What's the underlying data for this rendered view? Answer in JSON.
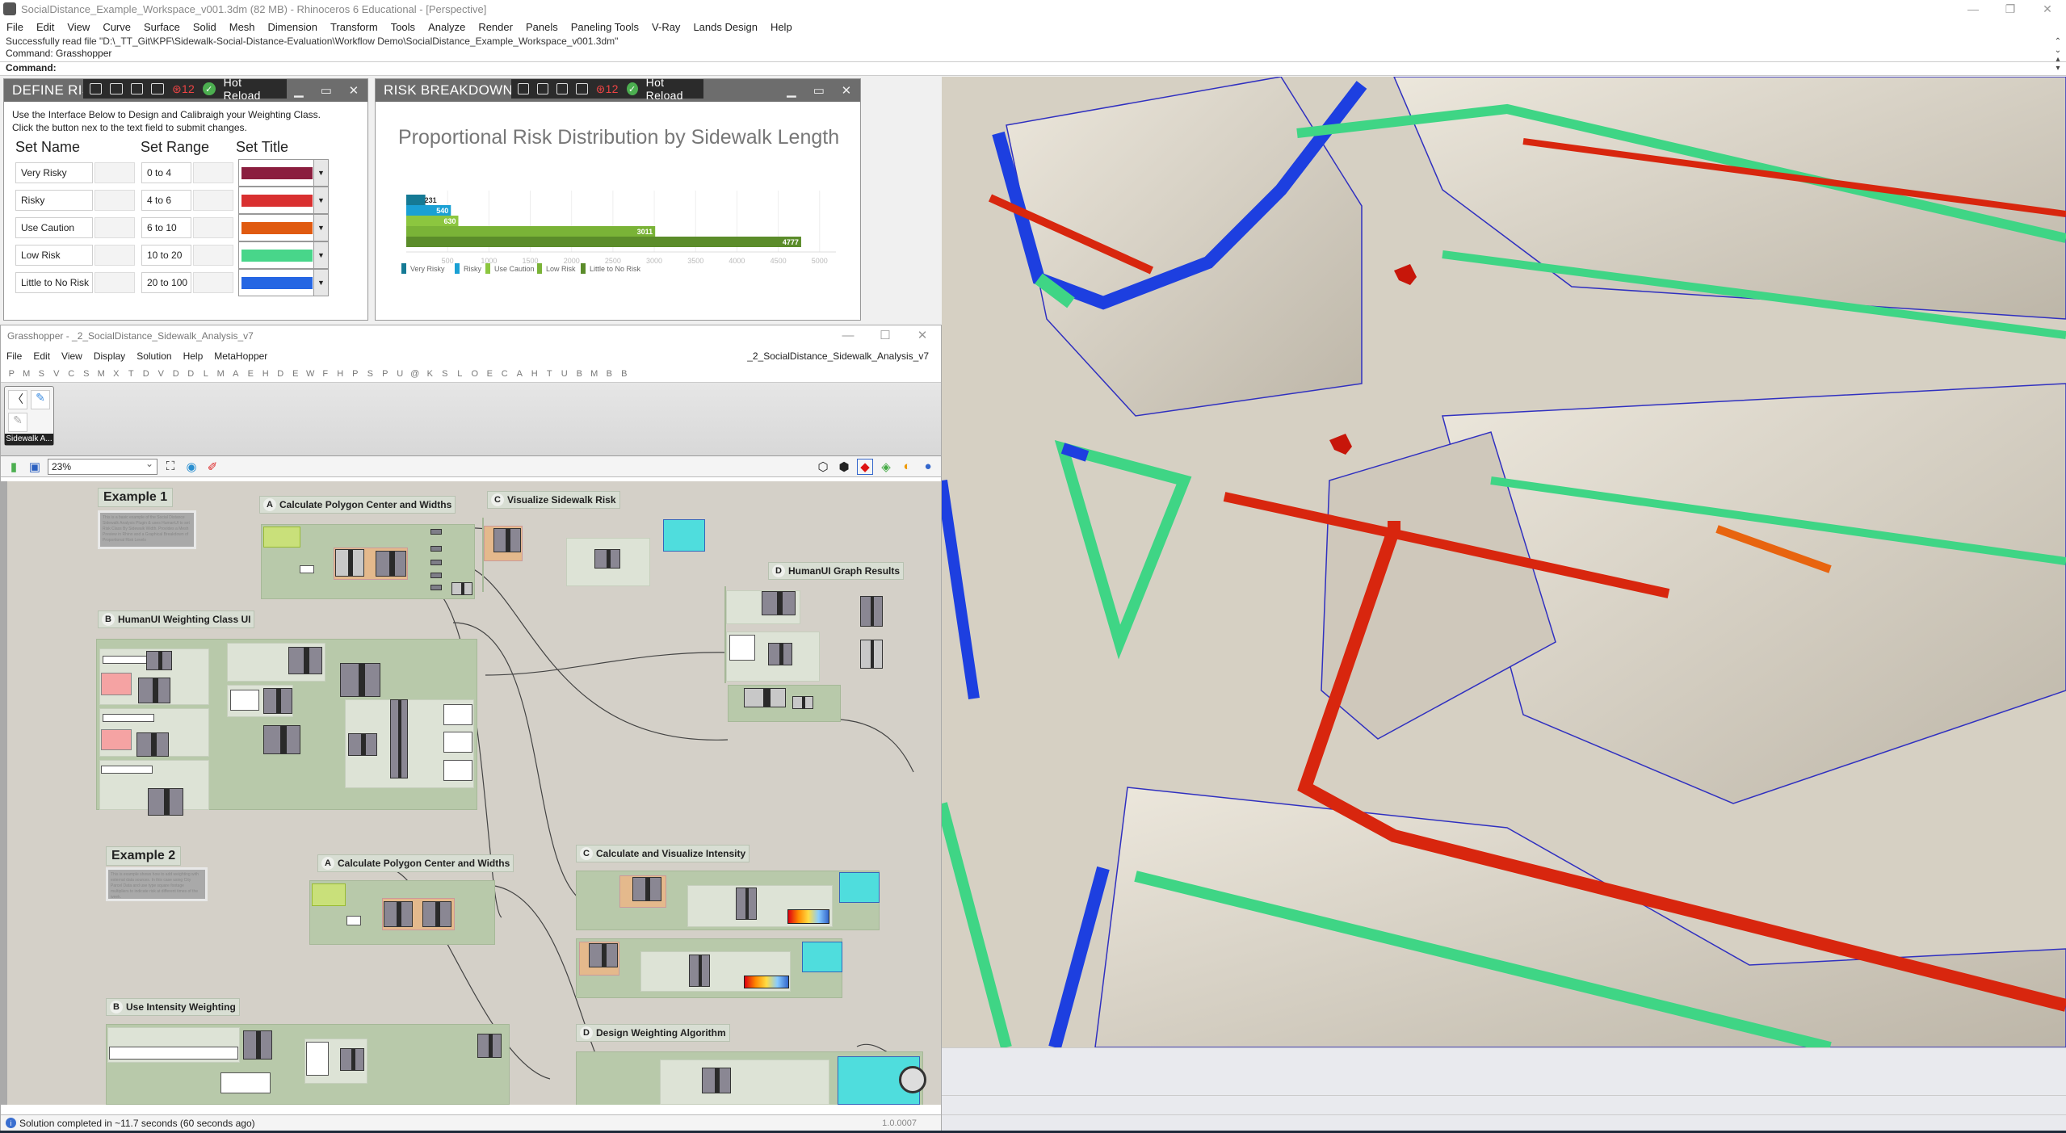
{
  "window": {
    "title": "SocialDistance_Example_Workspace_v001.3dm (82 MB) - Rhinoceros 6 Educational - [Perspective]",
    "controls": [
      "minimize",
      "restore",
      "close"
    ]
  },
  "menu": [
    "File",
    "Edit",
    "View",
    "Curve",
    "Surface",
    "Solid",
    "Mesh",
    "Dimension",
    "Transform",
    "Tools",
    "Analyze",
    "Render",
    "Panels",
    "Paneling Tools",
    "V-Ray",
    "Lands Design",
    "Help"
  ],
  "command_area": {
    "history": [
      "Successfully read file \"D:\\_TT_Git\\KPF\\Sidewalk-Social-Distance-Evaluation\\Workflow Demo\\SocialDistance_Example_Workspace_v001.3dm\"",
      "Command: Grasshopper"
    ],
    "prompt": "Command:"
  },
  "humanui_toolbar": {
    "issues_count": "12",
    "hot_reload": "Hot Reload"
  },
  "define_risk": {
    "title": "DEFINE RISK",
    "description_1": "Use the Interface Below to Design and Calibraigh your Weighting Class.",
    "description_2": "Click the button nex to the text field to submit changes.",
    "headers": [
      "Set Name",
      "Set Range",
      "Set Title"
    ],
    "rows": [
      {
        "name": "Very Risky",
        "range": "0 to 4",
        "color": "#8b1e3f"
      },
      {
        "name": "Risky",
        "range": "4 to 6",
        "color": "#d93030"
      },
      {
        "name": "Use Caution",
        "range": "6 to 10",
        "color": "#e05a10"
      },
      {
        "name": "Low Risk",
        "range": "10 to 20",
        "color": "#48d68a"
      },
      {
        "name": "Little to No Risk",
        "range": "20 to 100",
        "color": "#2566e3"
      }
    ]
  },
  "risk_breakdown": {
    "title": "RISK BREAKDOWN"
  },
  "chart_data": {
    "type": "bar",
    "orientation": "horizontal",
    "title": "Proportional Risk Distribution by  Sidewalk Length",
    "categories": [
      "Very Risky",
      "Risky",
      "Use Caution",
      "Low Risk",
      "Little to No Risk"
    ],
    "values": [
      231,
      540,
      630,
      3011,
      4777
    ],
    "colors": [
      "#157a95",
      "#1aa0d4",
      "#8cc63f",
      "#7ab337",
      "#5b8c2a"
    ],
    "xticks": [
      500,
      1000,
      1500,
      2000,
      2500,
      3000,
      3500,
      4000,
      4500,
      5000
    ],
    "xlim": [
      0,
      5100
    ],
    "grid": true,
    "legend": "bottom-left",
    "xlabel": "",
    "ylabel": ""
  },
  "grasshopper": {
    "title": "Grasshopper - _2_SocialDistance_Sidewalk_Analysis_v7",
    "menu": [
      "File",
      "Edit",
      "View",
      "Display",
      "Solution",
      "Help",
      "MetaHopper"
    ],
    "document_name": "_2_SocialDistance_Sidewalk_Analysis_v7",
    "tabs": [
      "P",
      "M",
      "S",
      "V",
      "C",
      "S",
      "M",
      "X",
      "T",
      "D",
      "V",
      "D",
      "D",
      "L",
      "M",
      "A",
      "E",
      "H",
      "D",
      "E",
      "W",
      "F",
      "H",
      "P",
      "S",
      "P",
      "U",
      "@",
      "K",
      "S",
      "L",
      "O",
      "E",
      "C",
      "A",
      "H",
      "T",
      "U",
      "B",
      "M",
      "B",
      "B"
    ],
    "ribbon_group": "Sidewalk A...",
    "zoom": "23%",
    "canvas": {
      "example1": {
        "title": "Example 1",
        "note": "This is a basic example of the Social Distance Sidewalk Analysis Plugin & uses HumanUI to set Risk Class By Sidewalk Width. Provides a Mesh Preview in Rhino and a Graphical Breakdown of Proportional Risk Levels",
        "groups": [
          {
            "letter": "A",
            "label": "Calculate Polygon Center and Widths"
          },
          {
            "letter": "B",
            "label": "HumanUI Weighting Class UI"
          },
          {
            "letter": "C",
            "label": "Visualize Sidewalk Risk"
          },
          {
            "letter": "D",
            "label": "HumanUI Graph Results"
          }
        ]
      },
      "example2": {
        "title": "Example 2",
        "note": "This is example shows how to add weighting with external data sources. In this case using City Parcel Data and use type square footage multipliers to indicate risk at different times of the week.",
        "groups": [
          {
            "letter": "A",
            "label": "Calculate Polygon Center and Widths"
          },
          {
            "letter": "B",
            "label": "Use Intensity Weighting"
          },
          {
            "letter": "C",
            "label": "Calculate and Visualize Intensity"
          },
          {
            "letter": "D",
            "label": "Design Weighting Algorithm"
          }
        ]
      }
    },
    "status": "Solution completed in ~11.7 seconds (60 seconds ago)",
    "version": "1.0.0007"
  },
  "viewport": {
    "name": "Perspective",
    "risk_colors": {
      "high": "#d8260e",
      "caution": "#e8640f",
      "low": "#3fd585",
      "none": "#1d3fe0"
    }
  }
}
